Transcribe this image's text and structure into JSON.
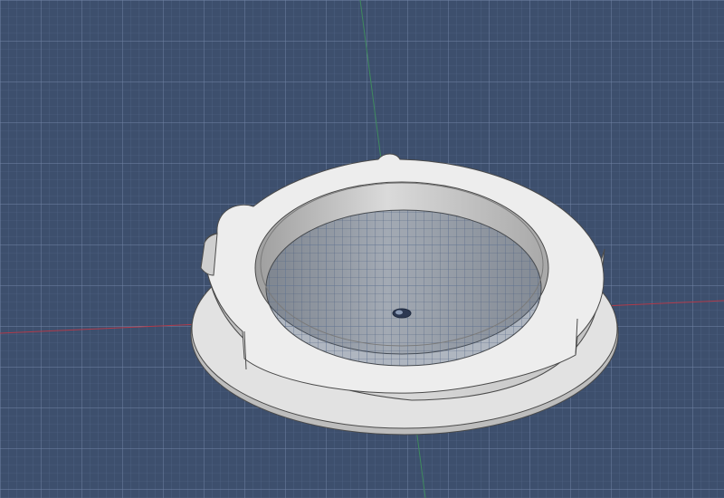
{
  "viewport": {
    "background_color": "#3d4f6d",
    "grid_minor_color": "#56688a",
    "grid_major_color": "#7386a6",
    "axis_x_color": "#b03a4a",
    "axis_y_color": "#3f8a5e",
    "show_grid": true
  },
  "model": {
    "type": "ring-flange-part",
    "top_face_color": "#ededed",
    "side_face_color": "#cfcfcf",
    "flange_color": "#e2e2e2",
    "inner_wall_color": "#bdbdbd",
    "edge_color": "#4a4a4a"
  },
  "icons": {
    "origin": "origin-marker-icon"
  }
}
